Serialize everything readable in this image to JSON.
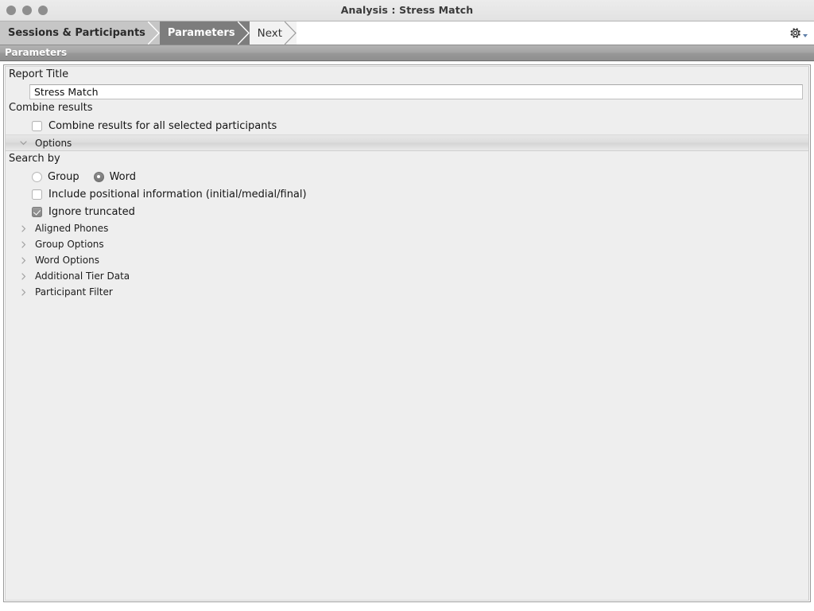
{
  "window": {
    "title": "Analysis : Stress Match",
    "traffic_lights": [
      "close-button",
      "minimize-button",
      "zoom-button"
    ]
  },
  "breadcrumb": {
    "items": [
      {
        "label": "Sessions & Participants",
        "state": "done"
      },
      {
        "label": "Parameters",
        "state": "current"
      },
      {
        "label": "Next",
        "state": "next"
      }
    ],
    "settings_icon": "gear-icon"
  },
  "section": {
    "header": "Parameters"
  },
  "form": {
    "report_title": {
      "label": "Report Title",
      "value": "Stress Match",
      "placeholder": ""
    },
    "combine_results": {
      "label": "Combine results",
      "checkbox_label": "Combine results for all selected participants",
      "checked": false
    },
    "options": {
      "label": "Options",
      "expanded": true
    },
    "search_by": {
      "label": "Search by",
      "radios": [
        {
          "label": "Group",
          "selected": false
        },
        {
          "label": "Word",
          "selected": true
        }
      ],
      "checkboxes": [
        {
          "label": "Include positional information (initial/medial/final)",
          "checked": false
        },
        {
          "label": "Ignore truncated",
          "checked": true
        }
      ]
    },
    "collapsed_sections": [
      {
        "label": "Aligned Phones",
        "expanded": false
      },
      {
        "label": "Group Options",
        "expanded": false
      },
      {
        "label": "Word Options",
        "expanded": false
      },
      {
        "label": "Additional Tier Data",
        "expanded": false
      },
      {
        "label": "Participant Filter",
        "expanded": false
      }
    ]
  },
  "colors": {
    "titlebar": "#ececec",
    "crumb_current": "#7d7d7d",
    "crumb_done": "#c6c6c6",
    "crumb_next": "#f2f2f2",
    "section_header": "#9c9c9c",
    "panel_background": "#eeeeee",
    "accent_caret": "#5f7fa8"
  }
}
